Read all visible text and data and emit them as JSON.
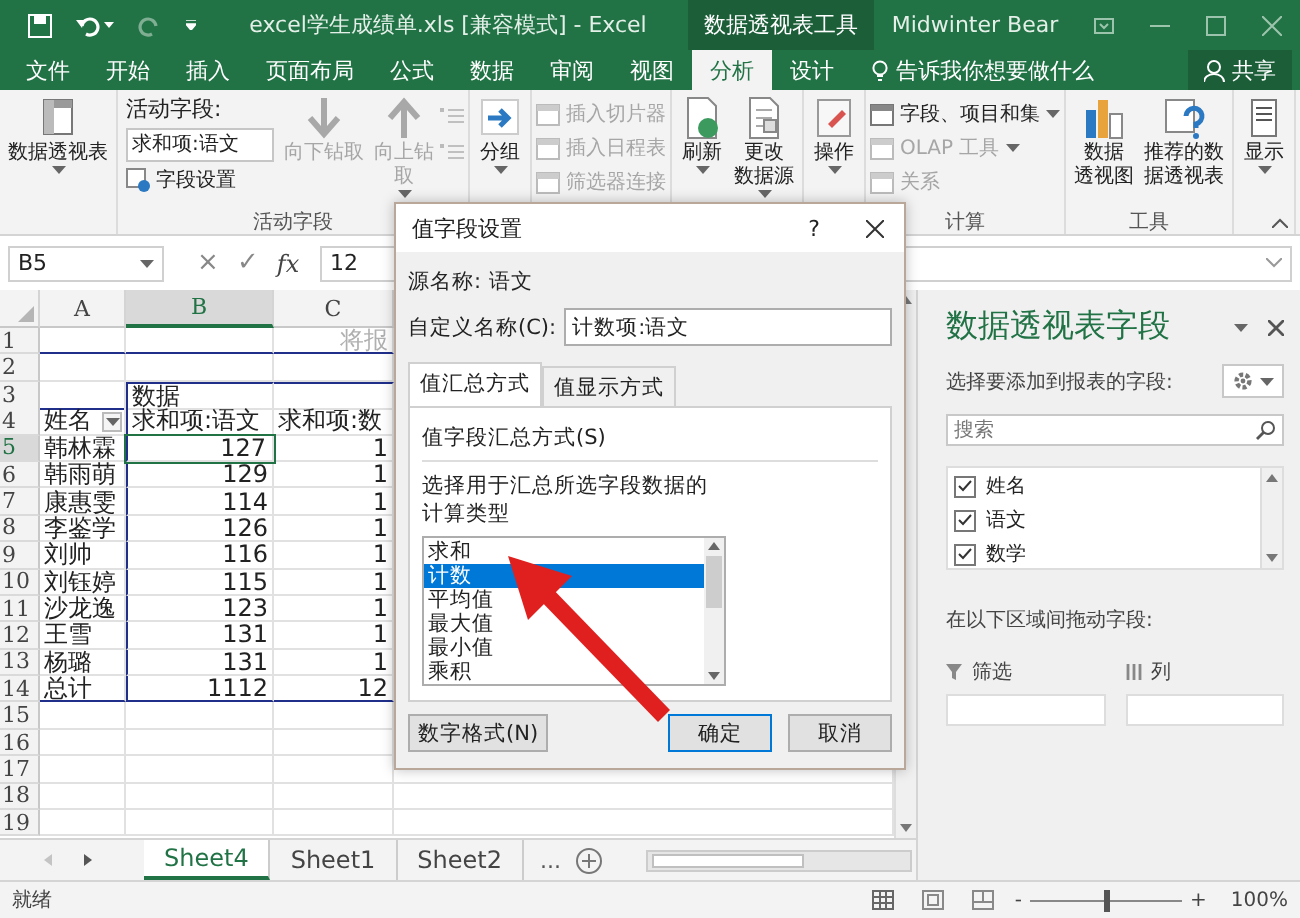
{
  "title_bar": {
    "title": "excel学生成绩单.xls  [兼容模式]  -  Excel",
    "context_label": "数据透视表工具",
    "user": "Midwinter Bear"
  },
  "ribbon_tabs": [
    {
      "label": "文件",
      "selected": false
    },
    {
      "label": "开始",
      "selected": false
    },
    {
      "label": "插入",
      "selected": false
    },
    {
      "label": "页面布局",
      "selected": false
    },
    {
      "label": "公式",
      "selected": false
    },
    {
      "label": "数据",
      "selected": false
    },
    {
      "label": "审阅",
      "selected": false
    },
    {
      "label": "视图",
      "selected": false
    },
    {
      "label": "分析",
      "selected": true
    },
    {
      "label": "设计",
      "selected": false
    }
  ],
  "tell_me": "告诉我你想要做什么",
  "share": "共享",
  "ribbon_groups": [
    {
      "items": [
        {
          "kind": "large",
          "lines": [
            "数据透视表"
          ],
          "menu": true,
          "disabled": false
        }
      ]
    },
    {
      "label": "活动字段",
      "items": [
        {
          "kind": "active_field",
          "caption": "活动字段:",
          "value": "求和项:语文",
          "link": "字段设置"
        },
        {
          "kind": "large",
          "lines": [
            "向下钻取"
          ],
          "menu": false,
          "disabled": true
        },
        {
          "kind": "large",
          "lines": [
            "向上钻",
            "取"
          ],
          "menu": true,
          "disabled": true
        },
        {
          "kind": "toggles",
          "disabled": true
        }
      ]
    },
    {
      "items": [
        {
          "kind": "large",
          "lines": [
            "分组"
          ],
          "menu": true,
          "disabled": false
        }
      ]
    },
    {
      "items": [
        {
          "kind": "smalls",
          "rows": [
            {
              "label": "插入切片器",
              "menu": false,
              "disabled": true
            },
            {
              "label": "插入日程表",
              "menu": false,
              "disabled": true
            },
            {
              "label": "筛选器连接",
              "menu": false,
              "disabled": true
            }
          ]
        }
      ]
    },
    {
      "items": [
        {
          "kind": "large",
          "lines": [
            "刷新"
          ],
          "menu": true,
          "disabled": false
        },
        {
          "kind": "large",
          "lines": [
            "更改",
            "数据源"
          ],
          "menu": true,
          "disabled": false
        }
      ]
    },
    {
      "items": [
        {
          "kind": "large",
          "lines": [
            "操作"
          ],
          "menu": true,
          "disabled": false
        }
      ]
    },
    {
      "label": "计算",
      "items": [
        {
          "kind": "smalls",
          "rows": [
            {
              "label": "字段、项目和集",
              "menu": true,
              "disabled": false
            },
            {
              "label": "OLAP 工具",
              "menu": true,
              "disabled": true
            },
            {
              "label": "关系",
              "menu": false,
              "disabled": true
            }
          ]
        }
      ]
    },
    {
      "label": "工具",
      "items": [
        {
          "kind": "large",
          "lines": [
            "数据",
            "透视图"
          ],
          "menu": false,
          "disabled": false
        },
        {
          "kind": "large",
          "lines": [
            "推荐的数",
            "据透视表"
          ],
          "menu": false,
          "disabled": false
        }
      ]
    },
    {
      "items": [
        {
          "kind": "large",
          "lines": [
            "显示"
          ],
          "menu": true,
          "disabled": false
        }
      ]
    }
  ],
  "formula_bar": {
    "name_box": "B5",
    "cancel": "×",
    "enter": "✓",
    "function_label": "fx",
    "formula": "12"
  },
  "sheet": {
    "columns": [
      {
        "label": "A",
        "selected": false
      },
      {
        "label": "B",
        "selected": true
      },
      {
        "label": "C",
        "selected": false
      }
    ],
    "rows": [
      {
        "number": "1",
        "kind": "filter_area",
        "selected": false,
        "cells": {
          "col_c": "将报"
        }
      },
      {
        "number": "2",
        "kind": "blank",
        "selected": false
      },
      {
        "number": "3",
        "kind": "caption",
        "selected": false,
        "cells": {
          "col_b": "数据"
        }
      },
      {
        "number": "4",
        "kind": "header",
        "selected": false,
        "cells": {
          "col_a": "姓名",
          "col_b": "求和项:语文",
          "col_c": "求和项:数"
        }
      },
      {
        "number": "5",
        "kind": "data",
        "selected": true,
        "cells": {
          "col_a": "韩林霖",
          "col_b": "127",
          "col_c": "1"
        }
      },
      {
        "number": "6",
        "kind": "data",
        "selected": false,
        "cells": {
          "col_a": "韩雨萌",
          "col_b": "129",
          "col_c": "1"
        }
      },
      {
        "number": "7",
        "kind": "data",
        "selected": false,
        "cells": {
          "col_a": "康惠雯",
          "col_b": "114",
          "col_c": "1"
        }
      },
      {
        "number": "8",
        "kind": "data",
        "selected": false,
        "cells": {
          "col_a": "李鉴学",
          "col_b": "126",
          "col_c": "1"
        }
      },
      {
        "number": "9",
        "kind": "data",
        "selected": false,
        "cells": {
          "col_a": "刘帅",
          "col_b": "116",
          "col_c": "1"
        }
      },
      {
        "number": "10",
        "kind": "data",
        "selected": false,
        "cells": {
          "col_a": "刘钰婷",
          "col_b": "115",
          "col_c": "1"
        }
      },
      {
        "number": "11",
        "kind": "data",
        "selected": false,
        "cells": {
          "col_a": "沙龙逸",
          "col_b": "123",
          "col_c": "1"
        }
      },
      {
        "number": "12",
        "kind": "data",
        "selected": false,
        "cells": {
          "col_a": "王雪",
          "col_b": "131",
          "col_c": "1"
        }
      },
      {
        "number": "13",
        "kind": "data",
        "selected": false,
        "cells": {
          "col_a": "杨璐",
          "col_b": "131",
          "col_c": "1"
        }
      },
      {
        "number": "14",
        "kind": "total",
        "selected": false,
        "cells": {
          "col_a": "总计",
          "col_b": "1112",
          "col_c": "12"
        }
      },
      {
        "number": "15",
        "kind": "blank",
        "selected": false
      },
      {
        "number": "16",
        "kind": "blank",
        "selected": false
      },
      {
        "number": "17",
        "kind": "blank",
        "selected": false
      },
      {
        "number": "18",
        "kind": "blank",
        "selected": false
      },
      {
        "number": "19",
        "kind": "blank",
        "selected": false
      }
    ]
  },
  "sheet_tabs": {
    "tabs": [
      {
        "label": "Sheet4",
        "selected": true
      },
      {
        "label": "Sheet1",
        "selected": false
      },
      {
        "label": "Sheet2",
        "selected": false
      }
    ],
    "more": "..."
  },
  "status_bar": {
    "status": "就绪",
    "zoom_out": "-",
    "zoom_in": "+",
    "zoom_slider": {
      "level": 0.5
    },
    "zoom": "100%"
  },
  "field_pane": {
    "title": "数据透视表字段",
    "subtitle": "选择要添加到报表的字段:",
    "search": {
      "placeholder": "搜索"
    },
    "fields": [
      {
        "label": "姓名",
        "checked": true
      },
      {
        "label": "语文",
        "checked": true
      },
      {
        "label": "数学",
        "checked": true
      }
    ],
    "drag_hint": "在以下区域间拖动字段:",
    "areas": [
      {
        "label": "筛选"
      },
      {
        "label": "列"
      }
    ]
  },
  "dialog": {
    "title": "值字段设置",
    "help": "?",
    "source_label": "源名称:",
    "source_value": "语文",
    "custom_label": "自定义名称(C):",
    "custom_value": "计数项:语文",
    "tabs": [
      {
        "label": "值汇总方式",
        "selected": true
      },
      {
        "label": "值显示方式",
        "selected": false
      }
    ],
    "section": "值字段汇总方式(S)",
    "description": [
      "选择用于汇总所选字段数据的",
      "计算类型"
    ],
    "options": [
      {
        "label": "求和",
        "selected": false
      },
      {
        "label": "计数",
        "selected": true
      },
      {
        "label": "平均值",
        "selected": false
      },
      {
        "label": "最大值",
        "selected": false
      },
      {
        "label": "最小值",
        "selected": false
      },
      {
        "label": "乘积",
        "selected": false
      }
    ],
    "buttons": [
      {
        "label": "数字格式(N)",
        "kind": "plain"
      },
      {
        "label": "确定",
        "kind": "default"
      },
      {
        "label": "取消",
        "kind": "plain"
      }
    ]
  }
}
